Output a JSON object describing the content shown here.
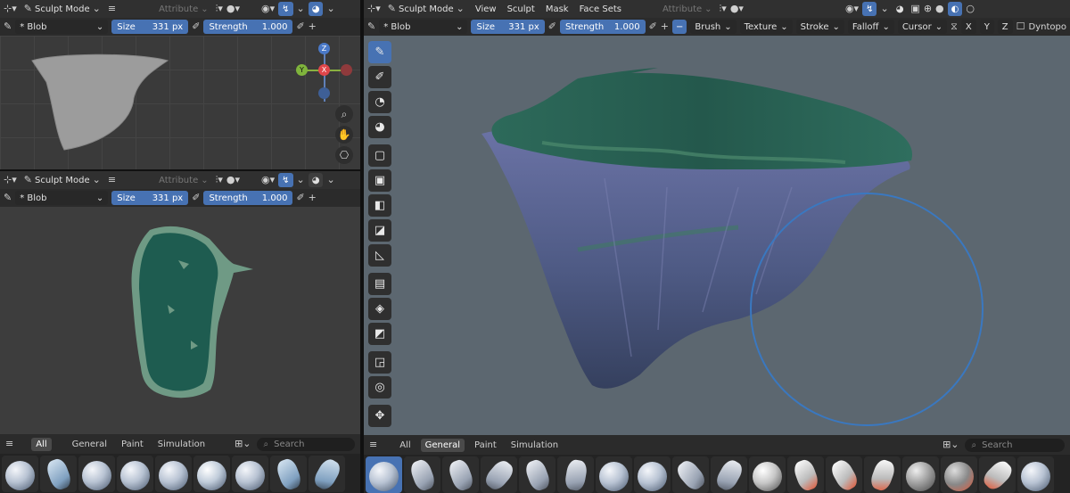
{
  "mode": "Sculpt Mode",
  "attribute": "Attribute",
  "brush_name": "* Blob",
  "size_label": "Size",
  "size_value": "331 px",
  "strength_label": "Strength",
  "strength_value": "1.000",
  "menus": [
    "View",
    "Sculpt",
    "Mask",
    "Face Sets"
  ],
  "main_dropdowns": [
    "Brush",
    "Texture",
    "Stroke",
    "Falloff",
    "Cursor"
  ],
  "axes": [
    "X",
    "Y",
    "Z"
  ],
  "dyntopo": "Dyntopo",
  "gizmo": {
    "z": "Z",
    "y": "Y",
    "x": "X"
  },
  "asset_tabs": [
    "All",
    "General",
    "Paint",
    "Simulation"
  ],
  "asset_active_left": "All",
  "asset_active_right": "General",
  "search_placeholder": "Search",
  "icons": [
    "menu-icon",
    "brush-icon",
    "zoom-icon",
    "hand-icon",
    "camera-icon",
    "search-icon"
  ]
}
